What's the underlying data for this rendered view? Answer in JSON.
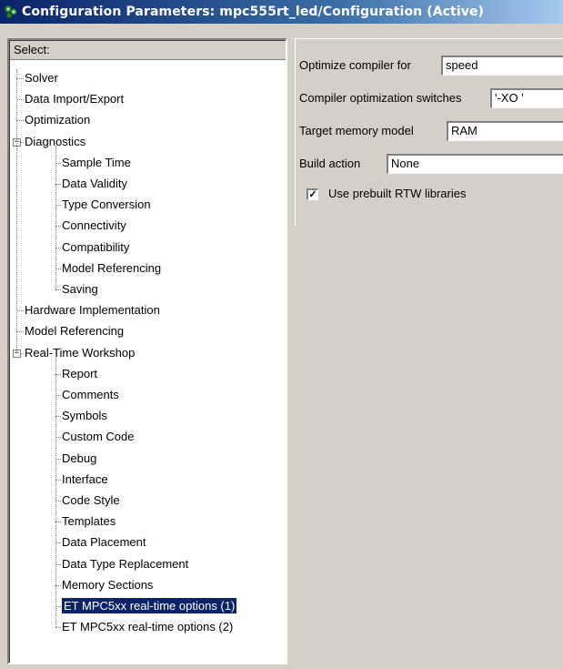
{
  "window": {
    "title": "Configuration Parameters: mpc555rt_led/Configuration (Active)",
    "icon": "simulink-config-icon"
  },
  "tree": {
    "header": "Select:",
    "items": [
      {
        "label": "Solver",
        "level": 1
      },
      {
        "label": "Data Import/Export",
        "level": 1
      },
      {
        "label": "Optimization",
        "level": 1
      },
      {
        "label": "Diagnostics",
        "level": 1,
        "expanded": true
      },
      {
        "label": "Sample Time",
        "level": 2
      },
      {
        "label": "Data Validity",
        "level": 2
      },
      {
        "label": "Type Conversion",
        "level": 2
      },
      {
        "label": "Connectivity",
        "level": 2
      },
      {
        "label": "Compatibility",
        "level": 2
      },
      {
        "label": "Model Referencing",
        "level": 2
      },
      {
        "label": "Saving",
        "level": 2
      },
      {
        "label": "Hardware Implementation",
        "level": 1
      },
      {
        "label": "Model Referencing",
        "level": 1
      },
      {
        "label": "Real-Time Workshop",
        "level": 1,
        "expanded": true
      },
      {
        "label": "Report",
        "level": 2
      },
      {
        "label": "Comments",
        "level": 2
      },
      {
        "label": "Symbols",
        "level": 2
      },
      {
        "label": "Custom Code",
        "level": 2
      },
      {
        "label": "Debug",
        "level": 2
      },
      {
        "label": "Interface",
        "level": 2
      },
      {
        "label": "Code Style",
        "level": 2
      },
      {
        "label": "Templates",
        "level": 2
      },
      {
        "label": "Data Placement",
        "level": 2
      },
      {
        "label": "Data Type Replacement",
        "level": 2
      },
      {
        "label": "Memory Sections",
        "level": 2
      },
      {
        "label": "ET MPC5xx real-time options (1)",
        "level": 2,
        "selected": true
      },
      {
        "label": "ET MPC5xx real-time options (2)",
        "level": 2
      }
    ]
  },
  "settings": {
    "optimize_compiler": {
      "label": "Optimize compiler for",
      "value": "speed"
    },
    "compiler_switches": {
      "label": "Compiler optimization switches",
      "value": "'-XO '"
    },
    "memory_model": {
      "label": "Target memory model",
      "value": "RAM"
    },
    "build_action": {
      "label": "Build action",
      "value": "None"
    },
    "prebuilt_libs": {
      "label": "Use prebuilt RTW libraries",
      "checked": true
    }
  },
  "colors": {
    "titlebar_start": "#0a246a",
    "selection": "#0a246a",
    "dialog_bg": "#d4d0c8"
  }
}
